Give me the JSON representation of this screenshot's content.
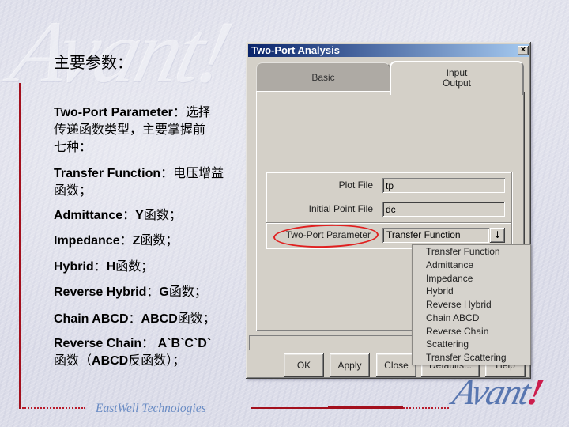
{
  "slide": {
    "watermark": "Avant!",
    "heading": "主要参数：",
    "bullets": [
      {
        "term": "Two-Port Parameter",
        "sep": "：",
        "desc": "选择",
        "continuation": [
          "传递函数类型，主要掌握前",
          "七种："
        ]
      },
      {
        "term": "Transfer Function",
        "sep": "：",
        "desc": "电压增益",
        "continuation": [
          "函数；"
        ]
      },
      {
        "term": "Admittance",
        "sep": "：",
        "symbol": "Y",
        "desc": "函数；"
      },
      {
        "term": "Impedance",
        "sep": "：",
        "symbol": "Z",
        "desc": "函数；"
      },
      {
        "term": "Hybrid",
        "sep": "：",
        "symbol": "H",
        "desc": "函数；"
      },
      {
        "term": "Reverse Hybrid",
        "sep": "：",
        "symbol": "G",
        "desc": "函数；"
      },
      {
        "term": "Chain ABCD",
        "sep": "：",
        "symbol": "ABCD",
        "desc": "函数；"
      },
      {
        "term": "Reverse Chain",
        "sep": "： ",
        "symbol": "A`B`C`D`",
        "continuation_parts": [
          "函数（",
          "ABCD",
          "反函数）；"
        ]
      }
    ],
    "footer": "EastWell Technologies",
    "logo": {
      "text": "Avant",
      "mark": "!"
    },
    "colors": {
      "accent_line": "#a3101d",
      "footer_text": "#6a8cc4",
      "logo_blue": "#5876b0",
      "logo_red": "#cc1d4d"
    }
  },
  "dialog": {
    "title": "Two-Port Analysis",
    "close_glyph": "×",
    "title_gradient": [
      "#0a246a",
      "#a6caf0"
    ],
    "tabs": [
      {
        "lines": [
          "Basic"
        ],
        "active": false
      },
      {
        "lines": [
          "Input",
          "Output"
        ],
        "active": true
      }
    ],
    "plot_file": {
      "label": "Plot File",
      "value": "tp"
    },
    "initial_point_file": {
      "label": "Initial Point File",
      "value": "dc"
    },
    "two_port_parameter": {
      "label": "Two-Port Parameter",
      "selected": "Transfer Function",
      "dropdown_glyph": "↓",
      "highlight_color": "#e02020",
      "options": [
        "Transfer Function",
        "Admittance",
        "Impedance",
        "Hybrid",
        "Reverse Hybrid",
        "Chain ABCD",
        "Reverse Chain",
        "Scattering",
        "Transfer Scattering"
      ]
    },
    "status_text": "",
    "buttons": {
      "ok": "OK",
      "apply": "Apply",
      "close": "Close",
      "defaults": "Defaults...",
      "help": "Help"
    }
  }
}
